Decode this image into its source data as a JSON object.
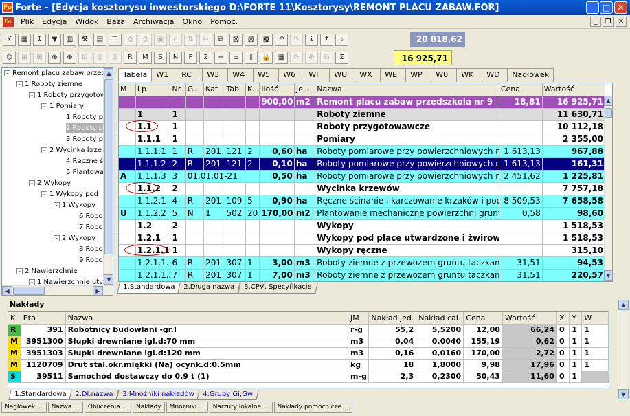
{
  "window": {
    "title": "Forte - [Edycja kosztorysu inwestorskiego D:\\FORTE 11\\Kosztorysy\\REMONT PLACU ZABAW.FOR]",
    "app_icon": "Fo"
  },
  "menu": {
    "items": [
      "Plik",
      "Edycja",
      "Widok",
      "Baza",
      "Archiwacja",
      "Okno",
      "Pomoc."
    ]
  },
  "toolbar": {
    "sum_total": "20 818,62",
    "sum_selected": "16 925,71"
  },
  "tree": {
    "nodes": [
      {
        "label": "Remont placu zabaw przec",
        "toggle": "-"
      },
      {
        "label": "1 Roboty ziemne",
        "toggle": "-"
      },
      {
        "label": "1 Roboty przygotow",
        "toggle": "-"
      },
      {
        "label": "1 Pomiary",
        "toggle": "-"
      },
      {
        "label": "1 Roboty p",
        "toggle": ""
      },
      {
        "label": "2 Roboty p",
        "toggle": ""
      },
      {
        "label": "3 Roboty p",
        "toggle": ""
      },
      {
        "label": "2 Wycinka krze",
        "toggle": "-"
      },
      {
        "label": "4 Ręczne ś",
        "toggle": ""
      },
      {
        "label": "5 Plantowa",
        "toggle": ""
      },
      {
        "label": "2 Wykopy",
        "toggle": "-"
      },
      {
        "label": "1 Wykopy pod",
        "toggle": "-"
      },
      {
        "label": "1 Wykopy",
        "toggle": "-"
      },
      {
        "label": "6 Robo",
        "toggle": ""
      },
      {
        "label": "7 Robo",
        "toggle": ""
      },
      {
        "label": "2 Wykopy",
        "toggle": "-"
      },
      {
        "label": "8 Robo",
        "toggle": ""
      },
      {
        "label": "9 Robo",
        "toggle": ""
      },
      {
        "label": "2 Nawierzchnie",
        "toggle": "-"
      },
      {
        "label": "1 Nawierzchnie utv",
        "toggle": "-"
      }
    ]
  },
  "grid_tabs": [
    "Tabela",
    "W1",
    "RC",
    "W3",
    "W4",
    "W5",
    "W6",
    "WI",
    "WU",
    "WX",
    "WE",
    "WP",
    "W0",
    "WK",
    "WD",
    "Nagłówek"
  ],
  "grid": {
    "columns": [
      "M",
      "Lp",
      "Nr",
      "G...",
      "Kat",
      "Tab",
      "K...",
      "Ilość",
      "Je...",
      "Nazwa",
      "Cena",
      "Wartość"
    ],
    "rows": [
      {
        "style": "top",
        "cells": [
          "",
          "",
          "",
          "",
          "",
          "",
          "",
          "900,00",
          "m2",
          "Remont placu zabaw przedszkola nr 9",
          "18,81",
          "16 925,71"
        ]
      },
      {
        "style": "grey",
        "cells": [
          "",
          "1",
          "1",
          "",
          "",
          "",
          "",
          "",
          "",
          "Roboty ziemne",
          "",
          "11 630,71"
        ]
      },
      {
        "style": "bold",
        "cells": [
          "",
          "1.1",
          "1",
          "",
          "",
          "",
          "",
          "",
          "",
          "Roboty przygotowawcze",
          "",
          "10 112,18"
        ]
      },
      {
        "style": "bold",
        "cells": [
          "",
          "1.1.1",
          "1",
          "",
          "",
          "",
          "",
          "",
          "",
          "Pomiary",
          "",
          "2 355,00"
        ]
      },
      {
        "style": "cyan",
        "cells": [
          "",
          "1.1.1.1",
          "1",
          "R",
          "201",
          "121",
          "2",
          "0,60",
          "ha",
          "Roboty pomiarowe przy powierzchniowych robotach",
          "1 613,13",
          "967,88"
        ]
      },
      {
        "style": "selrow",
        "cells": [
          "",
          "1.1.1.2",
          "2",
          "R",
          "201",
          "121",
          "2",
          "0,10",
          "ha",
          "Roboty pomiarowe przy powierzchniowych robotach",
          "1 613,13",
          "161,31"
        ]
      },
      {
        "style": "cyan",
        "cells": [
          "A",
          "1.1.1.3",
          "3",
          "01.01.01-21",
          "",
          "",
          "",
          "0,50",
          "ha",
          "Roboty pomiarowe przy powierzchniowych robotach",
          "2 451,62",
          "1 225,81"
        ]
      },
      {
        "style": "bold",
        "cells": [
          "",
          "1.1.2",
          "2",
          "",
          "",
          "",
          "",
          "",
          "",
          "Wycinka krzewów",
          "",
          "7 757,18"
        ]
      },
      {
        "style": "cyan",
        "cells": [
          "",
          "1.1.2.1",
          "4",
          "R",
          "201",
          "109",
          "5",
          "0,90",
          "ha",
          "Ręczne ścinanie i karczowanie krzaków i podszycia",
          "8 509,53",
          "7 658,58"
        ]
      },
      {
        "style": "cyan",
        "cells": [
          "U",
          "1.1.2.2",
          "5",
          "N",
          "1",
          "502",
          "20",
          "170,00",
          "m2",
          "Plantowanie mechaniczne powierzchni gruntu",
          "0,58",
          "98,60"
        ]
      },
      {
        "style": "bold",
        "cells": [
          "",
          "1.2",
          "2",
          "",
          "",
          "",
          "",
          "",
          "",
          "Wykopy",
          "",
          "1 518,53"
        ]
      },
      {
        "style": "bold",
        "cells": [
          "",
          "1.2.1",
          "1",
          "",
          "",
          "",
          "",
          "",
          "",
          "Wykopy pod place utwardzone i żwirowe",
          "",
          "1 518,53"
        ]
      },
      {
        "style": "bold",
        "cells": [
          "",
          "1.2.1.1",
          "1",
          "",
          "",
          "",
          "",
          "",
          "",
          "Wykopy ręczne",
          "",
          "315,10"
        ]
      },
      {
        "style": "cyan",
        "cells": [
          "",
          "1.2.1.1.1",
          "6",
          "R",
          "201",
          "307",
          "1",
          "3,00",
          "m3",
          "Roboty ziemne z przewozem gruntu taczkami",
          "31,51",
          "94,53"
        ]
      },
      {
        "style": "cyan",
        "cells": [
          "",
          "1.2.1.1.2",
          "7",
          "R",
          "201",
          "307",
          "1",
          "7,00",
          "m3",
          "Roboty ziemne z przewozem gruntu taczkami",
          "31,51",
          "220,57"
        ]
      }
    ]
  },
  "grid_bottom_tabs": [
    "1.Standardowa",
    "2.Długa nazwa",
    "3.CPV, Specyfikacje"
  ],
  "naklady": {
    "title": "Nakłady",
    "columns": [
      "K",
      "Eto",
      "Nazwa",
      "JM",
      "Nakład jed.",
      "Nakład cał.",
      "Cena",
      "Wartość",
      "X",
      "Y",
      "W"
    ],
    "rows": [
      {
        "k": "R",
        "cells": [
          "R",
          "391",
          "Robotnicy budowlani -gr.I",
          "r-g",
          "55,2",
          "5,5200",
          "12,00",
          "66,24",
          "0",
          "1",
          "1"
        ]
      },
      {
        "k": "M",
        "cells": [
          "M",
          "3951300",
          "Słupki drewniane igl.d:70 mm",
          "m3",
          "0,04",
          "0,0040",
          "155,19",
          "0,62",
          "0",
          "1",
          "1"
        ]
      },
      {
        "k": "M",
        "cells": [
          "M",
          "3951303",
          "Słupki drewniane igl.d:120 mm",
          "m3",
          "0,16",
          "0,0160",
          "170,00",
          "2,72",
          "0",
          "1",
          "1"
        ]
      },
      {
        "k": "M",
        "cells": [
          "M",
          "1120709",
          "Drut stal.okr.miękki (Na) ocynk.d:0.5mm",
          "kg",
          "18",
          "1,8000",
          "9,98",
          "17,96",
          "0",
          "1",
          "1"
        ]
      },
      {
        "k": "S",
        "cells": [
          "S",
          "39511",
          "Samochód dostawczy do 0.9 t (1)",
          "m-g",
          "2,3",
          "0,2300",
          "50,43",
          "11,60",
          "0",
          "1",
          ""
        ]
      }
    ],
    "tabs": [
      "1.Standardowa",
      "2.Dł.nazwa",
      "3.Mnożniki nakładów",
      "4.Grupy Gi,Gw"
    ]
  },
  "footer_buttons": [
    "Nagłówek ...",
    "Nazwa ...",
    "Obliczenia ...",
    "Nakłady",
    "Mnożniki ...",
    "Narzuty lokalne ...",
    "Nakłady pomocnicze ..."
  ]
}
